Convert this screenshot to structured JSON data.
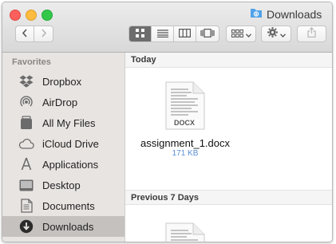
{
  "window": {
    "title": "Downloads"
  },
  "toolbar": {
    "back": "back",
    "forward": "forward",
    "views": [
      "icon",
      "list",
      "column",
      "cover-flow"
    ],
    "active_view": "icon",
    "group": "group",
    "action": "action",
    "share": "share"
  },
  "sidebar": {
    "heading": "Favorites",
    "items": [
      {
        "label": "Dropbox",
        "icon": "dropbox-icon"
      },
      {
        "label": "AirDrop",
        "icon": "airdrop-icon"
      },
      {
        "label": "All My Files",
        "icon": "all-files-icon"
      },
      {
        "label": "iCloud Drive",
        "icon": "cloud-icon"
      },
      {
        "label": "Applications",
        "icon": "applications-icon"
      },
      {
        "label": "Desktop",
        "icon": "desktop-icon"
      },
      {
        "label": "Documents",
        "icon": "documents-icon"
      },
      {
        "label": "Downloads",
        "icon": "downloads-icon",
        "selected": true
      }
    ]
  },
  "main": {
    "sections": [
      {
        "title": "Today",
        "files": [
          {
            "name": "assignment_1.docx",
            "size": "171 KB",
            "badge": "DOCX"
          }
        ]
      },
      {
        "title": "Previous 7 Days",
        "files": []
      }
    ]
  },
  "colors": {
    "selection": "#c5c1bf",
    "sidebar": "#e8e4e2",
    "accent": "#5a8fd6"
  }
}
